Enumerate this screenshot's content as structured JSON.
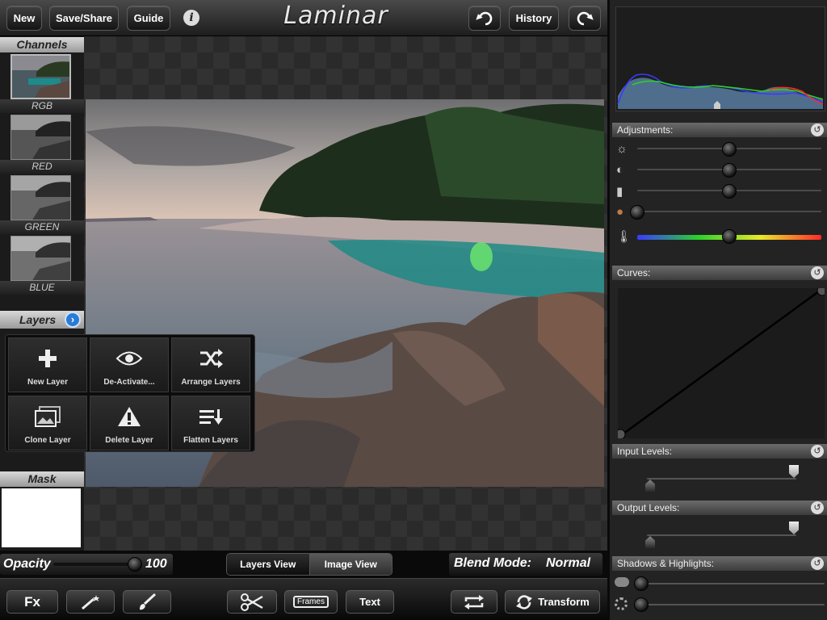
{
  "app": {
    "title": "Laminar"
  },
  "toolbar_top": {
    "new_label": "New",
    "save_share_label": "Save/Share",
    "guide_label": "Guide",
    "info_glyph": "i",
    "history_label": "History"
  },
  "left": {
    "channels_header": "Channels",
    "channels": [
      {
        "label": "RGB"
      },
      {
        "label": "RED"
      },
      {
        "label": "GREEN"
      },
      {
        "label": "BLUE"
      }
    ],
    "layers_header": "Layers",
    "mask_header": "Mask"
  },
  "layers_menu": {
    "items": [
      {
        "label": "New Layer",
        "icon": "plus-icon"
      },
      {
        "label": "De-Activate...",
        "icon": "eye-icon"
      },
      {
        "label": "Arrange Layers",
        "icon": "shuffle-icon"
      },
      {
        "label": "Clone Layer",
        "icon": "image-stack-icon"
      },
      {
        "label": "Delete Layer",
        "icon": "warning-icon"
      },
      {
        "label": "Flatten Layers",
        "icon": "flatten-icon"
      }
    ]
  },
  "options": {
    "opacity_label": "Opacity",
    "opacity_value": "100",
    "opacity_fraction": 1.0,
    "view_tabs": [
      {
        "label": "Layers View",
        "active": true
      },
      {
        "label": "Image View",
        "active": false
      }
    ],
    "blend_mode_label": "Blend Mode:",
    "blend_mode_value": "Normal"
  },
  "bottom_toolbar": {
    "fx_label": "Fx",
    "frames_label": "Frames",
    "text_label": "Text",
    "transform_label": "Transform"
  },
  "right": {
    "adjustments_header": "Adjustments:",
    "curves_header": "Curves:",
    "input_levels_header": "Input Levels:",
    "output_levels_header": "Output Levels:",
    "shadows_highlights_header": "Shadows & Highlights:",
    "adjustment_sliders": [
      {
        "icon": "brightness-icon",
        "value": 0.5
      },
      {
        "icon": "contrast-icon",
        "value": 0.5
      },
      {
        "icon": "saturation-icon",
        "value": 0.5
      },
      {
        "icon": "tone-icon",
        "value": 0.0
      },
      {
        "icon": "temperature-icon",
        "value": 0.5
      }
    ],
    "colors": {
      "hist_red": "#ff2a2a",
      "hist_green": "#2bd12b",
      "hist_blue": "#3a3aff",
      "hist_fill": "#4f6e8d"
    }
  }
}
